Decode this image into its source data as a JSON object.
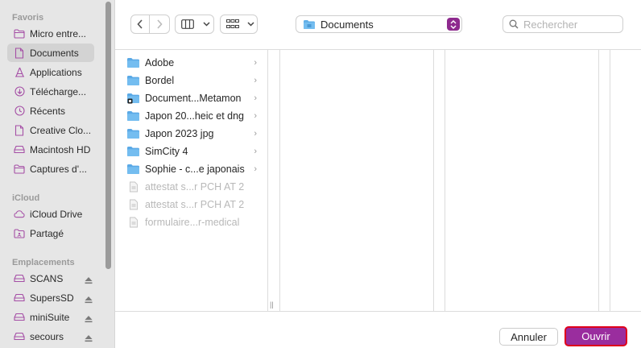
{
  "colors": {
    "accent": "#9a2d9e",
    "folder": "#62b0e8",
    "sidebar_icon": "#a54fa6",
    "highlight_border": "#e0001b"
  },
  "sidebar": {
    "sections": [
      {
        "title": "Favoris",
        "items": [
          {
            "label": "Micro entre...",
            "icon": "folder-icon"
          },
          {
            "label": "Documents",
            "icon": "document-icon",
            "selected": true
          },
          {
            "label": "Applications",
            "icon": "applications-icon"
          },
          {
            "label": "Télécharge...",
            "icon": "download-icon"
          },
          {
            "label": "Récents",
            "icon": "clock-icon"
          },
          {
            "label": "Creative Clo...",
            "icon": "document-icon"
          },
          {
            "label": "Macintosh HD",
            "icon": "drive-icon"
          },
          {
            "label": "Captures d'...",
            "icon": "folder-icon"
          }
        ]
      },
      {
        "title": "iCloud",
        "items": [
          {
            "label": "iCloud Drive",
            "icon": "cloud-icon"
          },
          {
            "label": "Partagé",
            "icon": "shared-folder-icon"
          }
        ]
      },
      {
        "title": "Emplacements",
        "items": [
          {
            "label": "SCANS",
            "icon": "drive-icon",
            "eject": true
          },
          {
            "label": "SupersSD",
            "icon": "drive-icon",
            "eject": true
          },
          {
            "label": "miniSuite",
            "icon": "drive-icon",
            "eject": true
          },
          {
            "label": "secours",
            "icon": "drive-icon",
            "eject": true
          }
        ]
      }
    ]
  },
  "toolbar": {
    "location_label": "Documents",
    "search_placeholder": "Rechercher"
  },
  "files": [
    {
      "name": "Adobe",
      "icon": "folder-icon",
      "chevron": true,
      "dim": false
    },
    {
      "name": "Bordel",
      "icon": "folder-icon",
      "chevron": true,
      "dim": false
    },
    {
      "name": "Document...Metamon",
      "icon": "app-folder-icon",
      "chevron": true,
      "dim": false
    },
    {
      "name": "Japon 20...heic et dng",
      "icon": "folder-icon",
      "chevron": true,
      "dim": false
    },
    {
      "name": "Japon 2023 jpg",
      "icon": "folder-icon",
      "chevron": true,
      "dim": false
    },
    {
      "name": "SimCity 4",
      "icon": "folder-icon",
      "chevron": true,
      "dim": false
    },
    {
      "name": "Sophie - c...e japonais",
      "icon": "folder-icon",
      "chevron": true,
      "dim": false
    },
    {
      "name": "attestat s...r PCH AT 2",
      "icon": "file-icon",
      "chevron": false,
      "dim": true
    },
    {
      "name": "attestat s...r PCH AT 2",
      "icon": "file-icon",
      "chevron": false,
      "dim": true
    },
    {
      "name": "formulaire...r-medical",
      "icon": "file-icon",
      "chevron": false,
      "dim": true
    }
  ],
  "footer": {
    "cancel_label": "Annuler",
    "open_label": "Ouvrir"
  }
}
